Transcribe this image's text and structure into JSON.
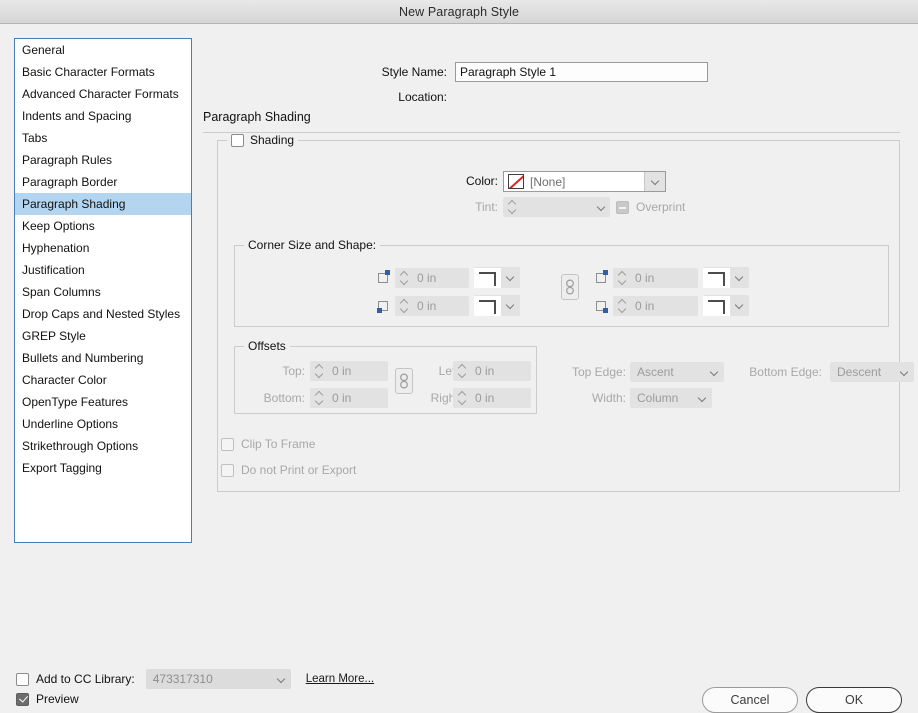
{
  "window": {
    "title": "New Paragraph Style"
  },
  "sidebar": {
    "items": [
      {
        "label": "General",
        "selected": false
      },
      {
        "label": "Basic Character Formats",
        "selected": false
      },
      {
        "label": "Advanced Character Formats",
        "selected": false
      },
      {
        "label": "Indents and Spacing",
        "selected": false
      },
      {
        "label": "Tabs",
        "selected": false
      },
      {
        "label": "Paragraph Rules",
        "selected": false
      },
      {
        "label": "Paragraph Border",
        "selected": false
      },
      {
        "label": "Paragraph Shading",
        "selected": true
      },
      {
        "label": "Keep Options",
        "selected": false
      },
      {
        "label": "Hyphenation",
        "selected": false
      },
      {
        "label": "Justification",
        "selected": false
      },
      {
        "label": "Span Columns",
        "selected": false
      },
      {
        "label": "Drop Caps and Nested Styles",
        "selected": false
      },
      {
        "label": "GREP Style",
        "selected": false
      },
      {
        "label": "Bullets and Numbering",
        "selected": false
      },
      {
        "label": "Character Color",
        "selected": false
      },
      {
        "label": "OpenType Features",
        "selected": false
      },
      {
        "label": "Underline Options",
        "selected": false
      },
      {
        "label": "Strikethrough Options",
        "selected": false
      },
      {
        "label": "Export Tagging",
        "selected": false
      }
    ]
  },
  "header": {
    "style_name_label": "Style Name:",
    "style_name_value": "Paragraph Style 1",
    "location_label": "Location:",
    "location_value": "",
    "section_title": "Paragraph Shading"
  },
  "shading": {
    "group_label": "Shading",
    "checked": false,
    "color_label": "Color:",
    "color_value": "[None]",
    "tint_label": "Tint:",
    "tint_value": "",
    "overprint_label": "Overprint"
  },
  "corner": {
    "group_label": "Corner Size and Shape:",
    "fields": [
      {
        "corner": "top-left",
        "value": "0 in"
      },
      {
        "corner": "bottom-left",
        "value": "0 in"
      },
      {
        "corner": "top-right",
        "value": "0 in"
      },
      {
        "corner": "bottom-right",
        "value": "0 in"
      }
    ],
    "link_icon": "chain-link-icon"
  },
  "offsets": {
    "group_label": "Offsets",
    "top_label": "Top:",
    "top_value": "0 in",
    "bottom_label": "Bottom:",
    "bottom_value": "0 in",
    "left_label": "Left:",
    "left_value": "0 in",
    "right_label": "Right:",
    "right_value": "0 in",
    "link_icon": "chain-link-icon"
  },
  "edges": {
    "top_edge_label": "Top Edge:",
    "top_edge_value": "Ascent",
    "bottom_edge_label": "Bottom Edge:",
    "bottom_edge_value": "Descent",
    "width_label": "Width:",
    "width_value": "Column"
  },
  "options": {
    "clip_to_frame_label": "Clip To Frame",
    "clip_to_frame_checked": false,
    "do_not_print_label": "Do not Print or Export",
    "do_not_print_checked": false
  },
  "footer": {
    "cc_library_label": "Add to CC Library:",
    "cc_library_checked": false,
    "cc_library_value": "473317310",
    "learn_more_label": "Learn More...",
    "preview_label": "Preview",
    "preview_checked": true,
    "cancel_label": "Cancel",
    "ok_label": "OK"
  },
  "colors": {
    "selection_blue": "#b4d5f0",
    "sidebar_border": "#4a7ebb",
    "dialog_bg": "#f0f0f0",
    "swatch_none_slash": "#e02020",
    "corner_marker_blue": "#2f5fa8",
    "disabled_text": "#9b9b9b"
  }
}
